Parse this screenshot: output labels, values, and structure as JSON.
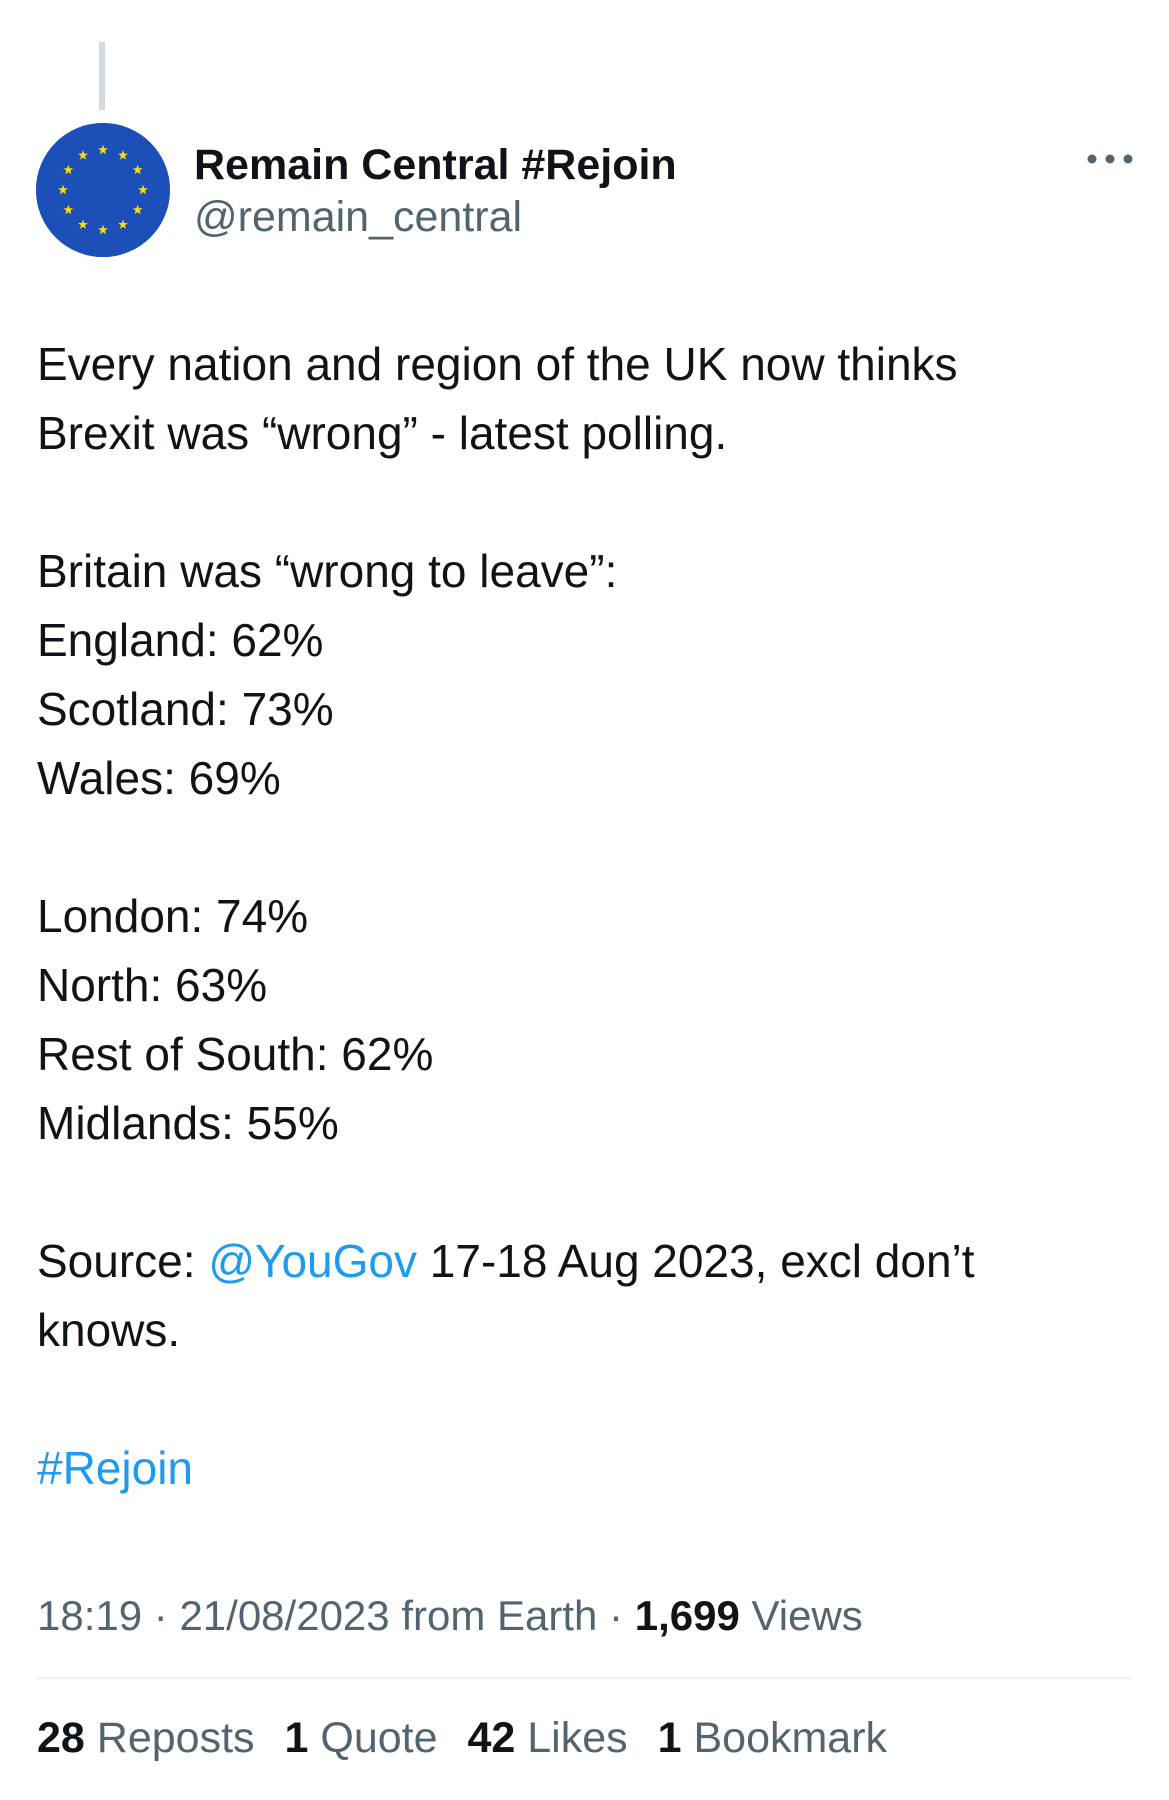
{
  "author": {
    "display_name": "Remain Central #Rejoin",
    "handle": "@remain_central",
    "avatar_icon": "eu-flag-icon",
    "avatar_color": "#1d4fb8",
    "star_color": "#ffdd00"
  },
  "tweet": {
    "intro_line1": "Every nation and region of the UK now thinks",
    "intro_line2": "Brexit was “wrong” - latest polling.",
    "heading": "Britain was “wrong to leave”:",
    "nations": [
      "England:  62%",
      "Scotland: 73%",
      "Wales: 69%"
    ],
    "regions": [
      "London: 74%",
      "North: 63%",
      "Rest of South: 62%",
      "Midlands: 55%"
    ],
    "source_prefix": "Source: ",
    "source_mention": "@YouGov",
    "source_suffix": " 17-18 Aug 2023, excl don’t",
    "source_line2": "knows.",
    "hashtag": "#Rejoin"
  },
  "meta": {
    "time": "18:19",
    "sep1": " · ",
    "date": "21/08/2023",
    "client": " from Earth",
    "sep2": " · ",
    "views_count": "1,699",
    "views_label": " Views"
  },
  "stats": {
    "reposts_count": "28",
    "reposts_label": " Reposts",
    "quotes_count": "1",
    "quotes_label": " Quote",
    "likes_count": "42",
    "likes_label": " Likes",
    "bookmarks_count": "1",
    "bookmarks_label": " Bookmark"
  },
  "colors": {
    "text": "#0f1419",
    "secondary": "#536471",
    "link": "#1d9bf0",
    "divider": "#eff3f4"
  }
}
